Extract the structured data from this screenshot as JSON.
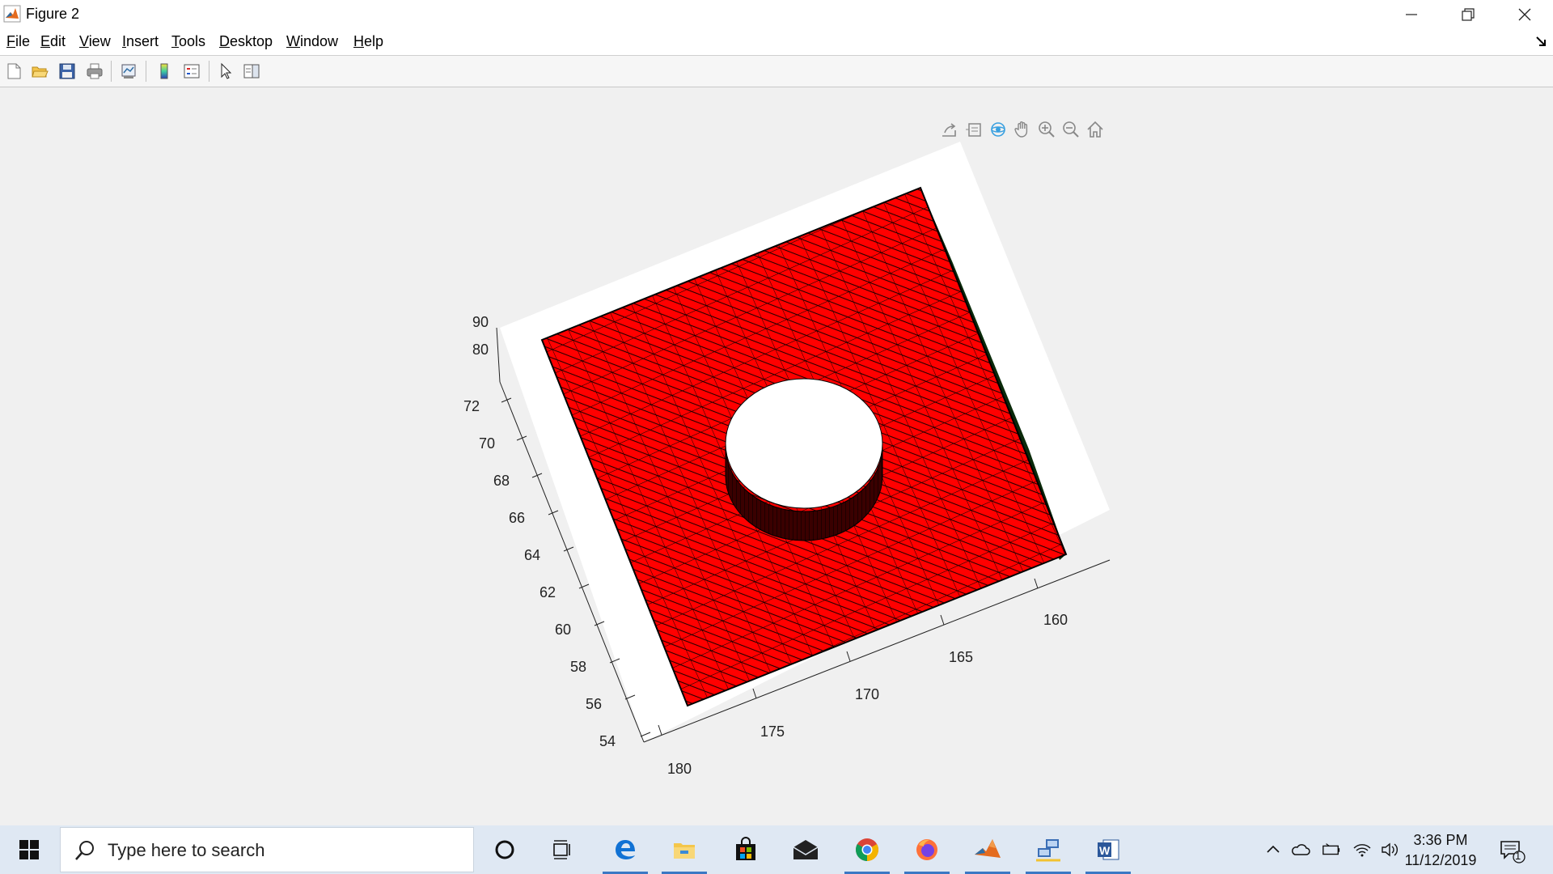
{
  "window": {
    "title": "Figure 2",
    "minimize_icon": "minimize-icon",
    "restore_icon": "restore-icon",
    "close_icon": "close-icon"
  },
  "menu": {
    "items": [
      {
        "mnemonic": "F",
        "rest": "ile"
      },
      {
        "mnemonic": "E",
        "rest": "dit"
      },
      {
        "mnemonic": "V",
        "rest": "iew"
      },
      {
        "mnemonic": "I",
        "rest": "nsert"
      },
      {
        "mnemonic": "T",
        "rest": "ools"
      },
      {
        "mnemonic": "D",
        "rest": "esktop"
      },
      {
        "mnemonic": "W",
        "rest": "indow"
      },
      {
        "mnemonic": "H",
        "rest": "elp"
      }
    ]
  },
  "toolbar": {
    "icons": [
      "new-figure-icon",
      "open-file-icon",
      "save-icon",
      "print-icon",
      "link-plot-icon",
      "insert-colorbar-icon",
      "insert-legend-icon",
      "edit-plot-icon",
      "property-inspector-icon"
    ]
  },
  "axes_toolbar": {
    "icons": [
      "export-icon",
      "brush-icon",
      "rotate-3d-icon",
      "pan-icon",
      "zoom-in-icon",
      "zoom-out-icon",
      "home-icon"
    ]
  },
  "chart_data": {
    "type": "surface-mesh-3d",
    "description_of_marks": "Red triangulated mesh plate with a circular hole, viewed in 3D",
    "face_color": "#ff0000",
    "edge_color": "#000000",
    "z_ticks": [
      "90",
      "80"
    ],
    "y_ticks": [
      "72",
      "70",
      "68",
      "66",
      "64",
      "62",
      "60",
      "58",
      "56",
      "54"
    ],
    "x_ticks": [
      "160",
      "165",
      "170",
      "175",
      "180"
    ]
  },
  "taskbar": {
    "search_placeholder": "Type here to search",
    "apps": [
      "cortana-icon",
      "task-view-icon",
      "edge-icon",
      "file-explorer-icon",
      "store-icon",
      "mail-icon",
      "chrome-icon",
      "firefox-icon",
      "matlab-icon",
      "network-app-icon",
      "word-icon"
    ],
    "tray": [
      "show-hidden-icons-icon",
      "onedrive-icon",
      "battery-icon",
      "wifi-icon",
      "volume-icon"
    ],
    "time": "3:36 PM",
    "date": "11/12/2019",
    "notification_count": "1"
  }
}
